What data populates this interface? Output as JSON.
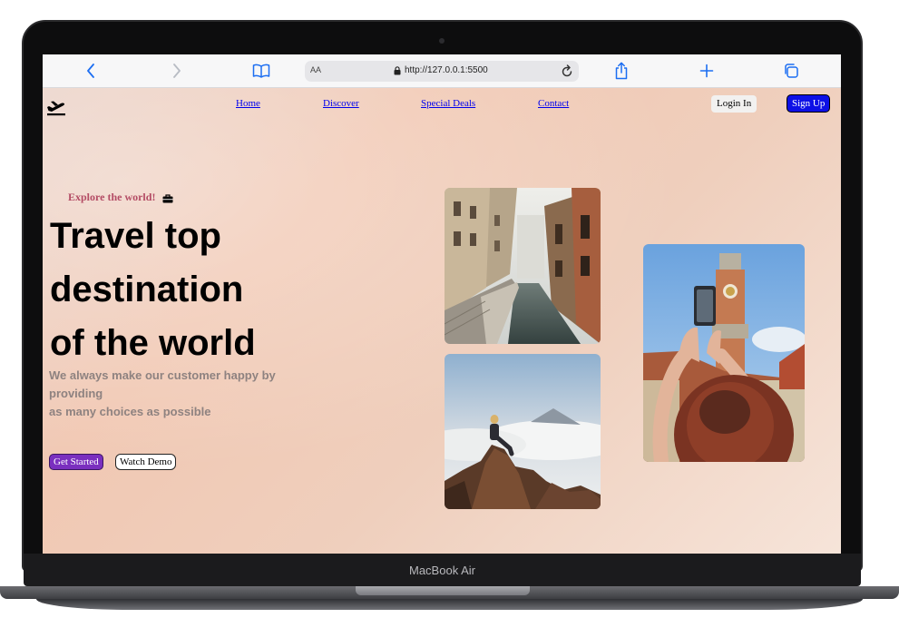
{
  "device": {
    "label": "MacBook Air"
  },
  "browser": {
    "text_size_button": "AA",
    "url": "http://127.0.0.1:5500",
    "icons": [
      "back-icon",
      "forward-icon",
      "bookmarks-icon",
      "lock-icon",
      "reload-icon",
      "share-icon",
      "new-tab-icon",
      "tabs-icon"
    ]
  },
  "nav": {
    "logo_icon": "plane-takeoff-icon",
    "links": [
      "Home",
      "Discover",
      "Special Deals",
      "Contact"
    ],
    "login_label": "Login In",
    "signup_label": "Sign Up"
  },
  "hero": {
    "tagline": "Explore the world!",
    "tagline_icon": "briefcase-icon",
    "title_lines": [
      "Travel top",
      "destination",
      "of the world"
    ],
    "subtitle_lines": [
      "We always make our customer happy by",
      "providing",
      "as many choices as possible"
    ],
    "primary_button": "Get Started",
    "secondary_button": "Watch Demo"
  },
  "gallery": {
    "images": [
      "venice-canal-photo",
      "mountain-hiker-photo",
      "clock-tower-selfie-photo"
    ]
  },
  "colors": {
    "accent_link": "#0000ee",
    "signup_bg": "#0d10e6",
    "tagline": "#b44c65",
    "get_started_bg": "#7a2fbf",
    "browser_icon": "#1c6ef2",
    "subtitle": "#8e8280"
  }
}
